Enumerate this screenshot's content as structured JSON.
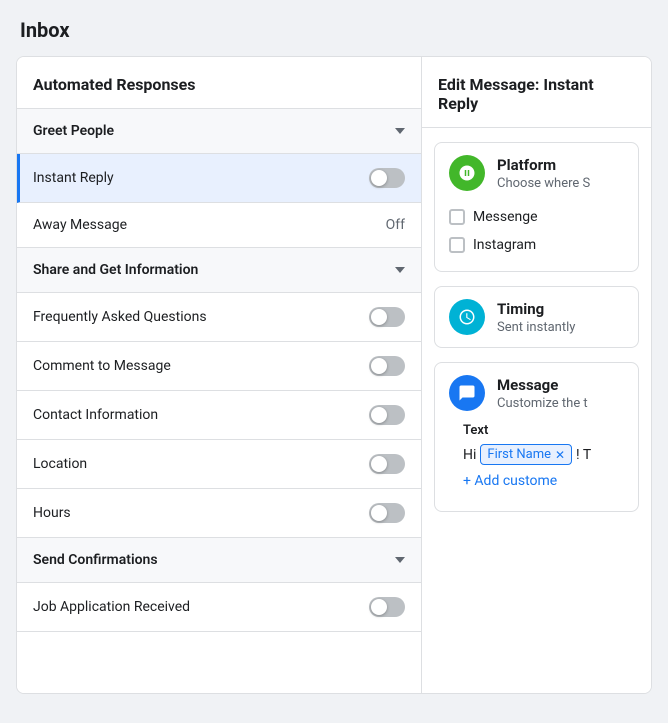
{
  "pageTitle": "Inbox",
  "leftPanel": {
    "title": "Automated Responses",
    "sections": [
      {
        "id": "greet-people",
        "label": "Greet People",
        "items": [
          {
            "id": "instant-reply",
            "label": "Instant Reply",
            "type": "toggle",
            "value": false,
            "active": true
          },
          {
            "id": "away-message",
            "label": "Away Message",
            "type": "text",
            "value": "Off"
          }
        ]
      },
      {
        "id": "share-get-info",
        "label": "Share and Get Information",
        "items": [
          {
            "id": "faq",
            "label": "Frequently Asked Questions",
            "type": "toggle",
            "value": false
          },
          {
            "id": "comment-to-message",
            "label": "Comment to Message",
            "type": "toggle",
            "value": false
          },
          {
            "id": "contact-info",
            "label": "Contact Information",
            "type": "toggle",
            "value": false
          },
          {
            "id": "location",
            "label": "Location",
            "type": "toggle",
            "value": false
          },
          {
            "id": "hours",
            "label": "Hours",
            "type": "toggle",
            "value": false
          }
        ]
      },
      {
        "id": "send-confirmations",
        "label": "Send Confirmations",
        "items": [
          {
            "id": "job-application",
            "label": "Job Application Received",
            "type": "toggle",
            "value": false
          }
        ]
      }
    ]
  },
  "rightPanel": {
    "title": "Edit Message: Instant Reply",
    "cards": [
      {
        "id": "platform-card",
        "iconType": "green",
        "iconName": "platform-icon",
        "title": "Platform",
        "subtitle": "Choose where S",
        "checkboxes": [
          {
            "id": "messenger-checkbox",
            "label": "Messenge"
          },
          {
            "id": "instagram-checkbox",
            "label": "Instagram"
          }
        ]
      },
      {
        "id": "timing-card",
        "iconType": "teal",
        "iconName": "timing-icon",
        "title": "Timing",
        "subtitle": "Sent instantly"
      },
      {
        "id": "message-card",
        "iconType": "blue",
        "iconName": "message-icon",
        "title": "Message",
        "subtitle": "Customize the t",
        "textLabel": "Text",
        "textPrefix": "Hi",
        "tagChip": "First Name",
        "textSuffix": "! T",
        "addCustomizeLabel": "+ Add custome"
      }
    ]
  }
}
